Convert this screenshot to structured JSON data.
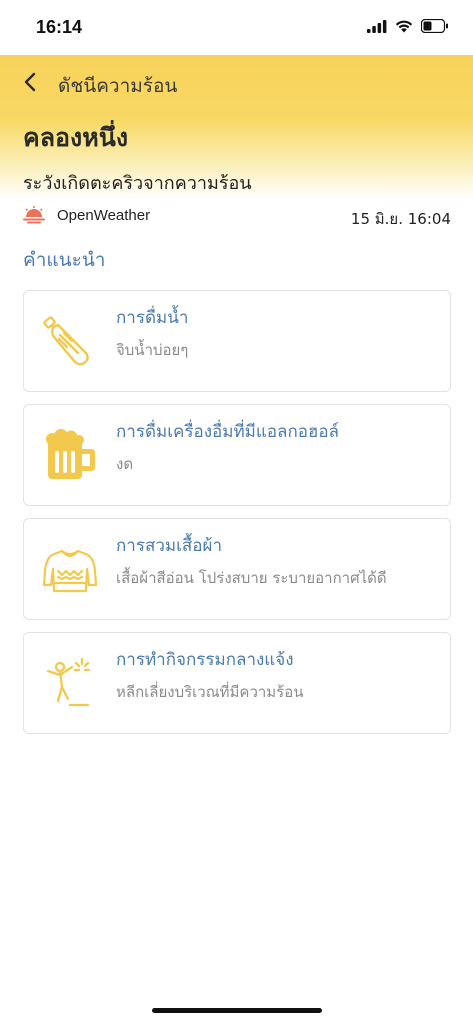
{
  "status_bar": {
    "time": "16:14"
  },
  "header": {
    "nav_title": "ดัชนีความร้อน",
    "level_title": "คลองหนึ่ง",
    "level_desc": "ระวังเกิดตะคริวจากความร้อน"
  },
  "source": {
    "name": "OpenWeather",
    "time": "15 มิ.ย. 16:04"
  },
  "section": {
    "title": "คำแนะนำ"
  },
  "advice": [
    {
      "title": "การดื่มน้ำ",
      "desc": "จิบน้ำบ่อยๆ",
      "icon": "water-bottle-icon"
    },
    {
      "title": "การดื่มเครื่องอื่มที่มีแอลกอฮอล์",
      "desc": "งด",
      "icon": "beer-mug-icon"
    },
    {
      "title": "การสวมเสื้อผ้า",
      "desc": "เสื้อผ้าสีอ่อน โปร่งสบาย ระบายอากาศได้ดี",
      "icon": "sweater-icon"
    },
    {
      "title": "การทำกิจกรรมกลางแจ้ง",
      "desc": "หลีกเลี่ยงบริเวณที่มีความร้อน",
      "icon": "person-sun-icon"
    }
  ],
  "colors": {
    "header": "#f7d25a",
    "accent": "#4a7ab0",
    "icon": "#f2c94c",
    "source_icon": "#e8735a"
  }
}
